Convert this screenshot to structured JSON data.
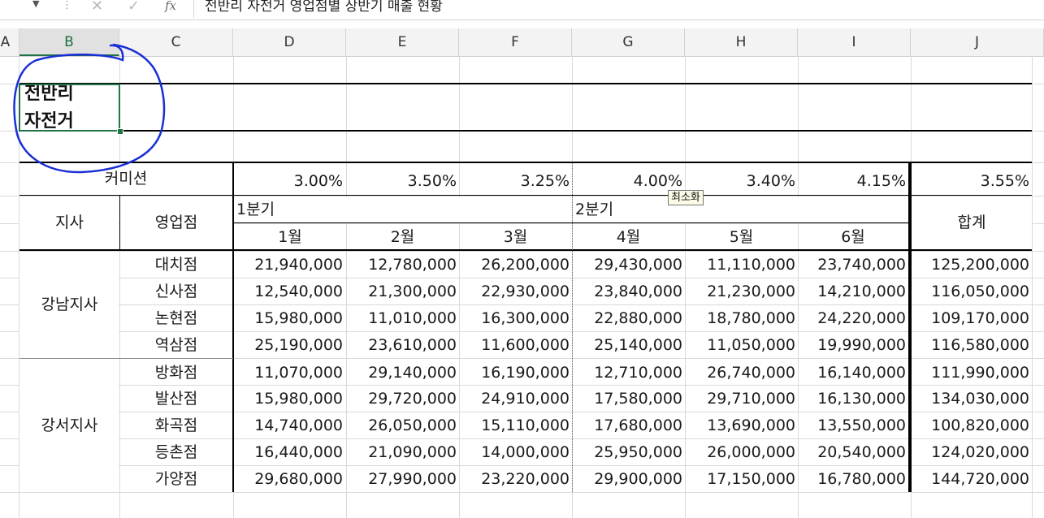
{
  "formula_bar": {
    "dropdown_icon": "chevron-down-icon",
    "cancel_icon": "cancel-x-icon",
    "enter_icon": "checkmark-icon",
    "fx_label": "fx",
    "content": "전반리 자전거 영업점별 상반기 매출 현황"
  },
  "columns": [
    "A",
    "B",
    "C",
    "D",
    "E",
    "F",
    "G",
    "H",
    "I",
    "J"
  ],
  "title": {
    "line1": "전반리",
    "line2": "자전거"
  },
  "commission": {
    "label": "커미션",
    "rates": [
      "3.00%",
      "3.50%",
      "3.25%",
      "4.00%",
      "3.40%",
      "4.15%",
      "3.55%"
    ]
  },
  "header": {
    "branch": "지사",
    "office": "영업점",
    "q1": "1분기",
    "q2": "2분기",
    "months": [
      "1월",
      "2월",
      "3월",
      "4월",
      "5월",
      "6월"
    ],
    "total": "합계"
  },
  "tooltip": "최소화",
  "groups": [
    {
      "branch": "강남지사",
      "rows": [
        {
          "office": "대치점",
          "values": [
            "21,940,000",
            "12,780,000",
            "26,200,000",
            "29,430,000",
            "11,110,000",
            "23,740,000"
          ],
          "total": "125,200,000"
        },
        {
          "office": "신사점",
          "values": [
            "12,540,000",
            "21,300,000",
            "22,930,000",
            "23,840,000",
            "21,230,000",
            "14,210,000"
          ],
          "total": "116,050,000"
        },
        {
          "office": "논현점",
          "values": [
            "15,980,000",
            "11,010,000",
            "16,300,000",
            "22,880,000",
            "18,780,000",
            "24,220,000"
          ],
          "total": "109,170,000"
        },
        {
          "office": "역삼점",
          "values": [
            "25,190,000",
            "23,610,000",
            "11,600,000",
            "25,140,000",
            "11,050,000",
            "19,990,000"
          ],
          "total": "116,580,000"
        }
      ]
    },
    {
      "branch": "강서지사",
      "rows": [
        {
          "office": "방화점",
          "values": [
            "11,070,000",
            "29,140,000",
            "16,190,000",
            "12,710,000",
            "26,740,000",
            "16,140,000"
          ],
          "total": "111,990,000"
        },
        {
          "office": "발산점",
          "values": [
            "15,980,000",
            "29,720,000",
            "24,910,000",
            "17,580,000",
            "29,710,000",
            "16,130,000"
          ],
          "total": "134,030,000"
        },
        {
          "office": "화곡점",
          "values": [
            "14,740,000",
            "26,050,000",
            "15,110,000",
            "17,680,000",
            "13,690,000",
            "13,550,000"
          ],
          "total": "100,820,000"
        },
        {
          "office": "등촌점",
          "values": [
            "16,440,000",
            "21,090,000",
            "14,000,000",
            "25,950,000",
            "26,000,000",
            "20,540,000"
          ],
          "total": "124,020,000"
        },
        {
          "office": "가양점",
          "values": [
            "29,680,000",
            "27,990,000",
            "23,220,000",
            "29,900,000",
            "17,150,000",
            "16,780,000"
          ],
          "total": "144,720,000"
        }
      ]
    }
  ],
  "colors": {
    "selection": "#217346",
    "annotation": "#1a2fd6"
  }
}
